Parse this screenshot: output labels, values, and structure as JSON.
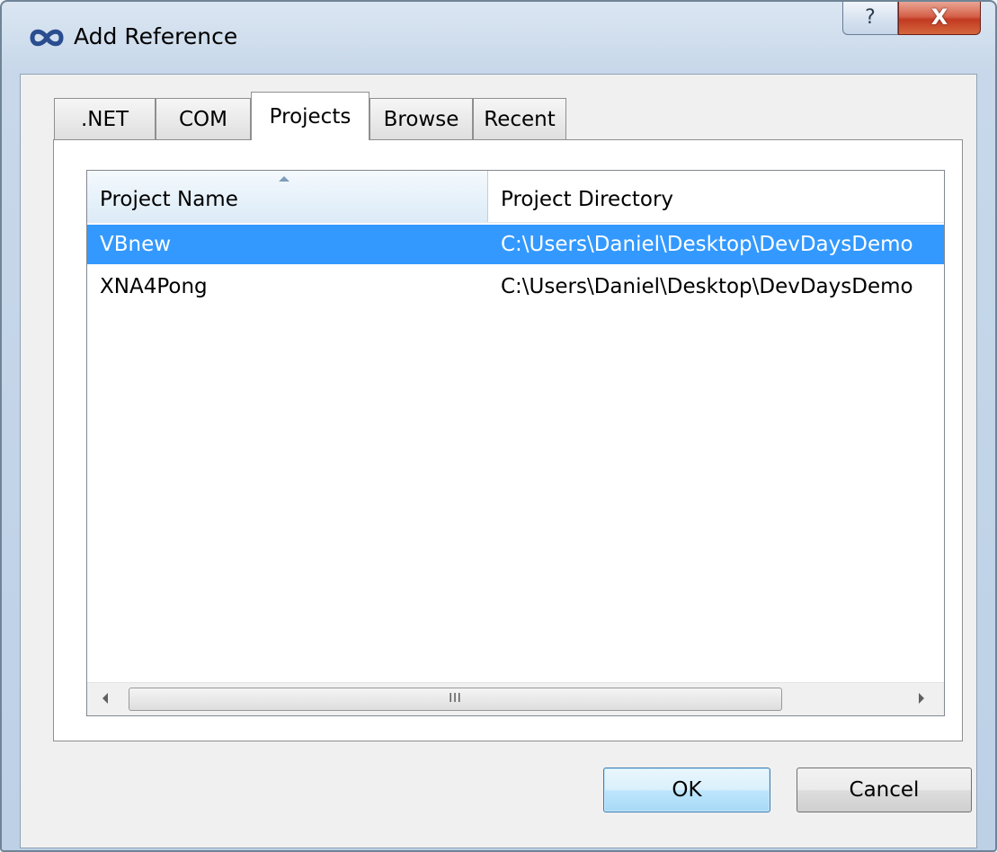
{
  "window": {
    "title": "Add Reference",
    "help_label": "?",
    "close_label": "X"
  },
  "tabs": [
    {
      "label": ".NET",
      "active": false
    },
    {
      "label": "COM",
      "active": false
    },
    {
      "label": "Projects",
      "active": true
    },
    {
      "label": "Browse",
      "active": false
    },
    {
      "label": "Recent",
      "active": false
    }
  ],
  "list": {
    "columns": [
      "Project Name",
      "Project Directory"
    ],
    "sorted_column": "Project Name",
    "rows": [
      {
        "name": "VBnew",
        "directory": "C:\\Users\\Daniel\\Desktop\\DevDaysDemo",
        "selected": true
      },
      {
        "name": "XNA4Pong",
        "directory": "C:\\Users\\Daniel\\Desktop\\DevDaysDemo",
        "selected": false
      }
    ],
    "scroll_grip": "III"
  },
  "buttons": {
    "ok_label": "OK",
    "cancel_label": "Cancel"
  },
  "icons": {
    "app": "infinity-icon",
    "sort": "sort-ascending-icon",
    "scroll_left": "scroll-left-arrow-icon",
    "scroll_right": "scroll-right-arrow-icon"
  },
  "colors": {
    "selection": "#3399ff",
    "close_button": "#c23a22",
    "default_button_border": "#3c7fb1"
  }
}
